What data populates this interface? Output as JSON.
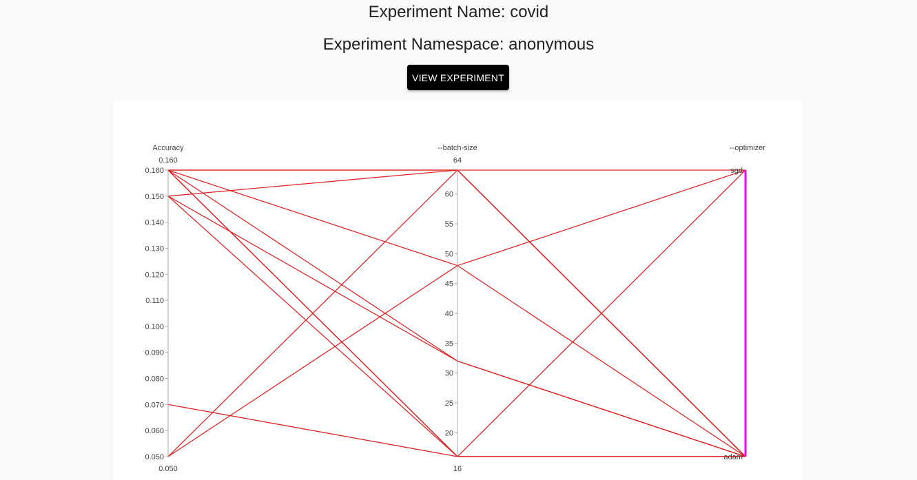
{
  "experiment": {
    "name_text": "Experiment Name: covid",
    "namespace_text": "Experiment Namespace: anonymous",
    "view_button_label": "VIEW EXPERIMENT"
  },
  "colors": {
    "line": "#dd1c1c",
    "highlight_axis": "#ff00ff",
    "axis": "#aaaaaa",
    "button_bg": "#000000"
  },
  "chart_data": {
    "type": "parallel-coordinates",
    "dimensions": [
      {
        "name": "Accuracy",
        "kind": "numeric",
        "range": [
          0.05,
          0.16
        ],
        "range_labels": {
          "top": "0.160",
          "bottom": "0.050"
        },
        "ticks": [
          0.16,
          0.15,
          0.14,
          0.13,
          0.12,
          0.11,
          0.1,
          0.09,
          0.08,
          0.07,
          0.06,
          0.05
        ],
        "tick_labels": [
          "0.160",
          "0.150",
          "0.140",
          "0.130",
          "0.120",
          "0.110",
          "0.100",
          "0.090",
          "0.080",
          "0.070",
          "0.060",
          "0.050"
        ]
      },
      {
        "name": "--batch-size",
        "kind": "numeric",
        "range": [
          16,
          64
        ],
        "range_labels": {
          "top": "64",
          "bottom": "16"
        },
        "ticks": [
          60,
          55,
          50,
          45,
          40,
          35,
          30,
          25,
          20
        ],
        "tick_labels": [
          "60",
          "55",
          "50",
          "45",
          "40",
          "35",
          "30",
          "25",
          "20"
        ]
      },
      {
        "name": "--optimizer",
        "kind": "categorical",
        "categories": [
          "adam",
          "sgd"
        ],
        "highlighted": true
      }
    ],
    "records": [
      {
        "accuracy": 0.16,
        "batch_size": 64,
        "optimizer": "sgd"
      },
      {
        "accuracy": 0.16,
        "batch_size": 64,
        "optimizer": "adam"
      },
      {
        "accuracy": 0.16,
        "batch_size": 48,
        "optimizer": "adam"
      },
      {
        "accuracy": 0.16,
        "batch_size": 32,
        "optimizer": "adam"
      },
      {
        "accuracy": 0.16,
        "batch_size": 16,
        "optimizer": "adam"
      },
      {
        "accuracy": 0.16,
        "batch_size": 16,
        "optimizer": "sgd"
      },
      {
        "accuracy": 0.15,
        "batch_size": 64,
        "optimizer": "adam"
      },
      {
        "accuracy": 0.15,
        "batch_size": 32,
        "optimizer": "adam"
      },
      {
        "accuracy": 0.15,
        "batch_size": 16,
        "optimizer": "adam"
      },
      {
        "accuracy": 0.07,
        "batch_size": 16,
        "optimizer": "adam"
      },
      {
        "accuracy": 0.05,
        "batch_size": 64,
        "optimizer": "adam"
      },
      {
        "accuracy": 0.05,
        "batch_size": 48,
        "optimizer": "sgd"
      }
    ]
  }
}
